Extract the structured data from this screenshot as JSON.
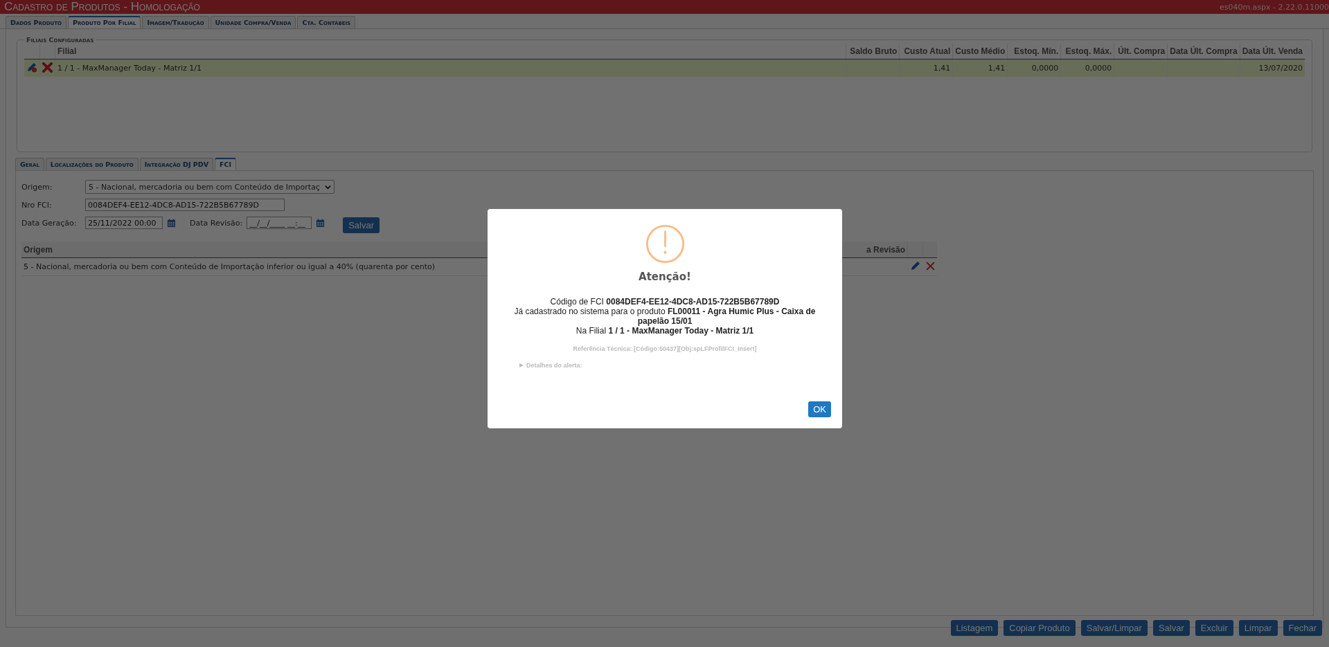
{
  "title_bar": {
    "title": "Cadastro de Produtos  - Homologação",
    "version": "es040m.aspx - 2.22.0.11000"
  },
  "tabs": [
    {
      "label": "Dados Produto",
      "selected": false
    },
    {
      "label": "Produto Por Filial",
      "selected": true
    },
    {
      "label": "Imagem/Tradução",
      "selected": false
    },
    {
      "label": "Unidade Compra/Venda",
      "selected": false
    },
    {
      "label": "Cta. Contábeis",
      "selected": false
    }
  ],
  "branches_panel": {
    "legend": "Filiais Configuradas",
    "columns": [
      "Filial",
      "Saldo Bruto",
      "Custo Atual",
      "Custo Médio",
      "Estoq. Mín.",
      "Estoq. Máx.",
      "Últ. Compra",
      "Data Últ. Compra",
      "Data Últ. Venda"
    ],
    "rows": [
      {
        "selected": true,
        "cells": [
          "1 / 1 - MaxManager Today - Matriz 1/1",
          null,
          "1,41",
          "1,41",
          "0,0000",
          "0,0000",
          null,
          null,
          "13/07/2020"
        ]
      }
    ]
  },
  "inner_tabs": [
    {
      "label": "Geral",
      "selected": false
    },
    {
      "label": "Localizações do Produto",
      "selected": false
    },
    {
      "label": "Integração DJ PDV",
      "selected": false
    },
    {
      "label": "FCI",
      "selected": true
    }
  ],
  "fci_form": {
    "origem_label": "Origem:",
    "origem_value": "5 - Nacional, mercadoria ou bem com Conteúdo de Importaç",
    "nro_label": "Nro FCI:",
    "nro_value": "0084DEF4-EE12-4DC8-AD15-722B5B67789D",
    "geracao_label": "Data Geração:",
    "geracao_value": "25/11/2022 00:00",
    "revisao_label": "Data Revisão:",
    "revisao_value": "__/__/____ __:__",
    "save": "Salvar"
  },
  "fci_table": {
    "columns": [
      "Origem",
      "a Revisão"
    ],
    "rows": [
      {
        "origem": "5 - Nacional, mercadoria ou bem com Conteúdo de Importação inferior ou igual a 40% (quarenta por cento)"
      }
    ]
  },
  "dialog": {
    "title": "Atenção!",
    "lines": [
      "Código de FCI **0084DEF4-EE12-4DC8-AD15-722B5B67789D**",
      "Já cadastrado no sistema para o produto **FL00011 - Agra Humic Plus - Caixa de papelão 15/01**",
      "Na Filial **1 / 1 - MaxManager Today - Matriz 1/1**"
    ],
    "reference": "Referência Técnica: [Código:50437][Obj:spLFProfilFCI_Insert]",
    "details": "Detalhes do alerta:",
    "ok": "OK"
  },
  "footer_buttons": [
    "Listagem",
    "Copiar Produto",
    "Salvar/Limpar",
    "Salvar",
    "Excluir",
    "Limpar",
    "Fechar"
  ]
}
